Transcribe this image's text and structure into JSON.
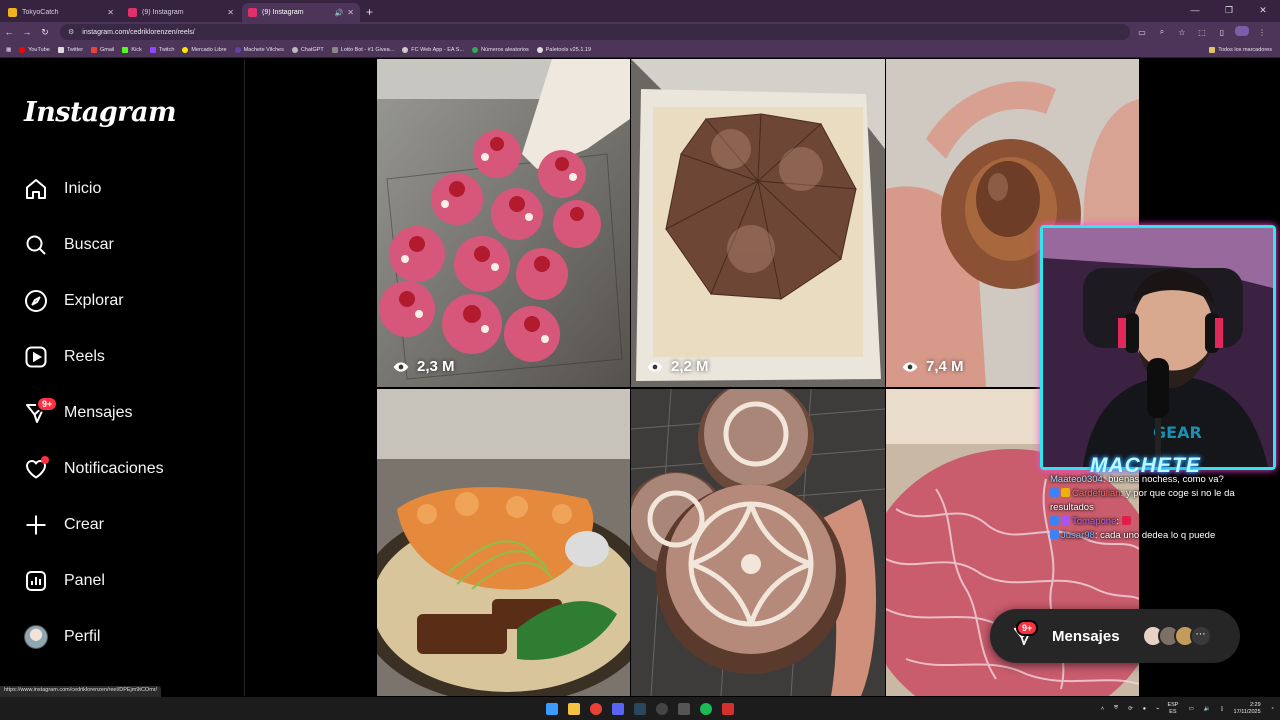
{
  "browser": {
    "tabs": [
      {
        "title": "TokyoCatch",
        "active": false,
        "favicon_color": "#f2b21f"
      },
      {
        "title": "(9) Instagram",
        "active": false,
        "favicon_color": "#e1306c"
      },
      {
        "title": "(9) Instagram",
        "active": true,
        "favicon_color": "#e1306c",
        "audio": true
      }
    ],
    "url": "instagram.com/cedriklorenzen/reels/",
    "bookmarks": [
      "YouTube",
      "Twitter",
      "Gmail",
      "Kick",
      "Twitch",
      "Mercado Libre",
      "Machete Vilches",
      "ChatGPT",
      "Lotto Bot - #1 Givea...",
      "FC Web App - EA S...",
      "Números aleatorios",
      "Paletools v25.1.19"
    ],
    "all_bookmarks": "Todos los marcadores"
  },
  "sidebar": {
    "logo": "Instagram",
    "items": [
      {
        "label": "Inicio",
        "icon": "home-icon"
      },
      {
        "label": "Buscar",
        "icon": "search-icon"
      },
      {
        "label": "Explorar",
        "icon": "compass-icon"
      },
      {
        "label": "Reels",
        "icon": "reels-icon"
      },
      {
        "label": "Mensajes",
        "icon": "messenger-icon",
        "badge": "9+"
      },
      {
        "label": "Notificaciones",
        "icon": "heart-icon",
        "dot": true
      },
      {
        "label": "Crear",
        "icon": "plus-icon"
      },
      {
        "label": "Panel",
        "icon": "dashboard-icon"
      },
      {
        "label": "Perfil",
        "icon": "avatar"
      }
    ]
  },
  "reels": [
    {
      "views": "2,3 M",
      "subject": "strawberry buns"
    },
    {
      "views": "2,2 M",
      "subject": "chocolate cake slices"
    },
    {
      "views": "7,4 M",
      "subject": "chocolate filled pastry"
    },
    {
      "views": "",
      "subject": "fried fish ramen"
    },
    {
      "views": "",
      "subject": "iced donuts"
    },
    {
      "views": "",
      "subject": "wagyu steak"
    }
  ],
  "stream": {
    "name": "MACHETE",
    "chat": [
      {
        "user": "Maateo0304",
        "msg": ": buenas nochess, como va?"
      },
      {
        "user": "Cardefulian",
        "msg": ": y por que coge si no le da resultados"
      },
      {
        "user": "Tomapone",
        "msg": ":"
      },
      {
        "user": "Jusar98",
        "msg": ": cada uno dedea lo q puede"
      }
    ]
  },
  "messages_bar": {
    "label": "Mensajes",
    "badge": "9+"
  },
  "status_link": "https://www.instagram.com/cedriklorenzen/reel/DPEjm9tCOmr/",
  "tray": {
    "lang_top": "ESP",
    "lang_bottom": "ES",
    "time": "2:29",
    "date": "17/11/2025"
  }
}
